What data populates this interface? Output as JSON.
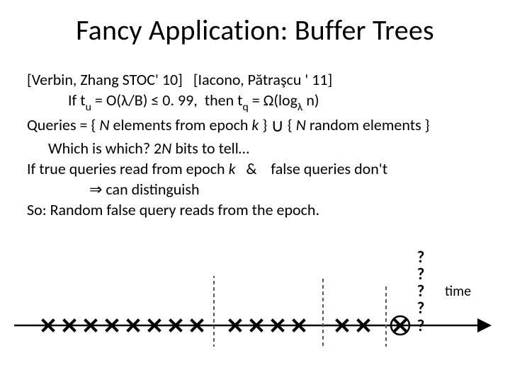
{
  "title": "Fancy Application: Buffer Trees",
  "refs": "[Verbin, Zhang STOC' 10]   [Iacono, Pătraşcu ' 11]",
  "line_if_pre": "If t",
  "line_if_sub1": "u",
  "line_if_mid1": " = O(λ/B) ≤ 0. 99,  then t",
  "line_if_sub2": "q",
  "line_if_mid2": " = Ω(log",
  "line_if_sub3": "λ",
  "line_if_post": " n)",
  "line_queries_pre": "Queries = { ",
  "line_queries_N1": "N",
  "line_queries_mid1": " elements from epoch ",
  "line_queries_k": "k",
  "line_queries_mid2": " } ",
  "cup": "∪",
  "line_queries_mid3": " { ",
  "line_queries_N2": "N",
  "line_queries_post": " random elements }",
  "line_which_pre": "Which is which? 2",
  "line_which_N": "N",
  "line_which_post": " bits to tell…",
  "line_true_pre": "If true queries read from epoch ",
  "line_true_k": "k",
  "line_true_mid": "   &    false queries don't",
  "line_imply": "⇒ can distinguish",
  "line_so": "So: Random false query reads from the epoch.",
  "q": "?",
  "time": "time"
}
